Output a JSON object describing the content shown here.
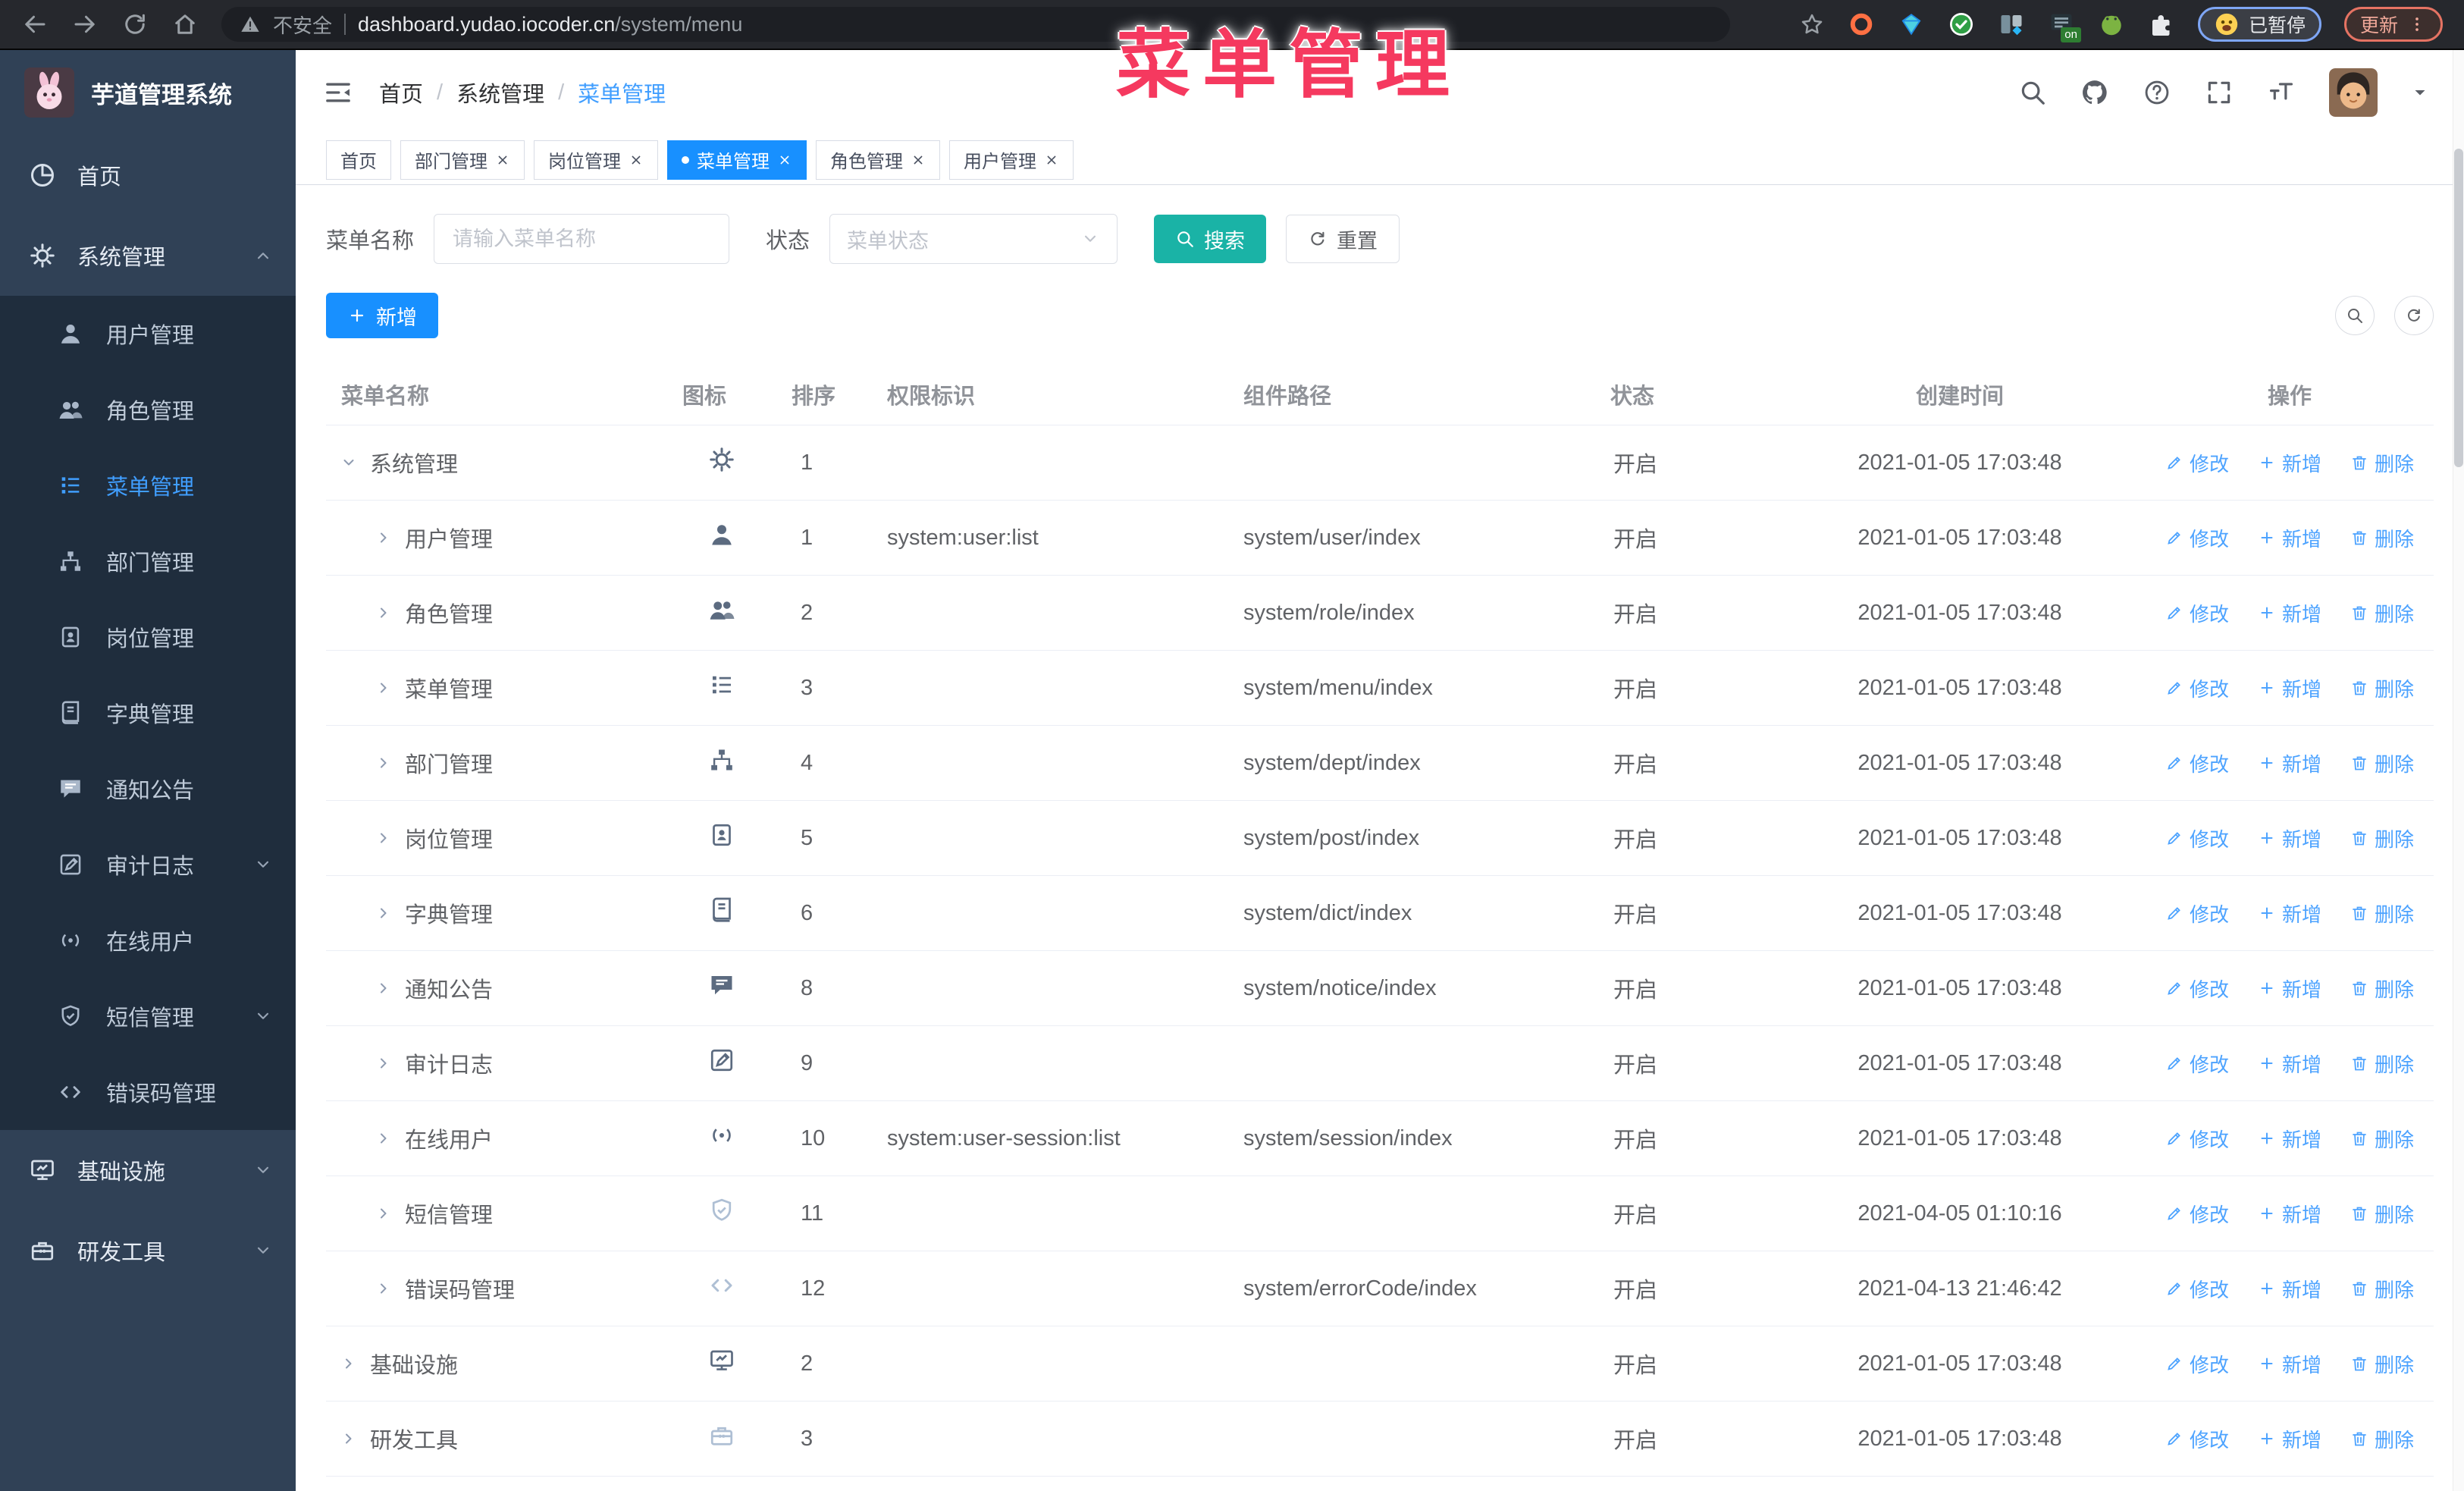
{
  "colors": {
    "primary": "#1890ff",
    "sidebar_active": "#409eff",
    "search_teal": "#1ab3a6",
    "overlay_pink": "#f5395f",
    "sidebar_bg": "#304156",
    "submenu_bg": "#1f2d3d"
  },
  "browser": {
    "security_label": "不安全",
    "url_host": "dashboard.yudao.iocoder.cn",
    "url_path": "/system/menu",
    "ext_on_badge": "on",
    "paused_badge": "已暂停",
    "update_button": "更新"
  },
  "overlay_title": "菜单管理",
  "sidebar": {
    "logo_title": "芋道管理系统",
    "items": [
      {
        "icon": "dashboard-icon",
        "label": "首页",
        "type": "root"
      },
      {
        "icon": "gear-icon",
        "label": "系统管理",
        "type": "root",
        "chevron": "up"
      },
      {
        "icon": "user-icon",
        "label": "用户管理",
        "type": "sub"
      },
      {
        "icon": "users-icon",
        "label": "角色管理",
        "type": "sub"
      },
      {
        "icon": "menu-list-icon",
        "label": "菜单管理",
        "type": "sub",
        "active": true
      },
      {
        "icon": "sitemap-icon",
        "label": "部门管理",
        "type": "sub"
      },
      {
        "icon": "badge-icon",
        "label": "岗位管理",
        "type": "sub"
      },
      {
        "icon": "book-icon",
        "label": "字典管理",
        "type": "sub"
      },
      {
        "icon": "comment-icon",
        "label": "通知公告",
        "type": "sub"
      },
      {
        "icon": "audit-log-icon",
        "label": "审计日志",
        "type": "sub",
        "chevron": "down"
      },
      {
        "icon": "online-user-icon",
        "label": "在线用户",
        "type": "sub"
      },
      {
        "icon": "shield-icon",
        "label": "短信管理",
        "type": "sub",
        "chevron": "down"
      },
      {
        "icon": "code-icon",
        "label": "错误码管理",
        "type": "sub"
      },
      {
        "icon": "monitor-icon",
        "label": "基础设施",
        "type": "root",
        "chevron": "down"
      },
      {
        "icon": "toolbox-icon",
        "label": "研发工具",
        "type": "root",
        "chevron": "down"
      }
    ]
  },
  "header": {
    "breadcrumb": [
      "首页",
      "系统管理",
      "菜单管理"
    ],
    "breadcrumb_separator": "/"
  },
  "tabs": [
    {
      "label": "首页",
      "closable": false,
      "active": false
    },
    {
      "label": "部门管理",
      "closable": true,
      "active": false
    },
    {
      "label": "岗位管理",
      "closable": true,
      "active": false
    },
    {
      "label": "菜单管理",
      "closable": true,
      "active": true
    },
    {
      "label": "角色管理",
      "closable": true,
      "active": false
    },
    {
      "label": "用户管理",
      "closable": true,
      "active": false
    }
  ],
  "filters": {
    "name_label": "菜单名称",
    "name_placeholder": "请输入菜单名称",
    "name_value": "",
    "status_label": "状态",
    "status_placeholder": "菜单状态",
    "search_button": "搜索",
    "reset_button": "重置"
  },
  "toolbar": {
    "add_button": "新增"
  },
  "table": {
    "columns": [
      "菜单名称",
      "图标",
      "排序",
      "权限标识",
      "组件路径",
      "状态",
      "创建时间",
      "操作"
    ],
    "actions": {
      "edit": "修改",
      "add": "新增",
      "delete": "删除"
    },
    "rows": [
      {
        "name": "系统管理",
        "depth": 1,
        "expanded": true,
        "icon": "gear-icon",
        "icon_light": false,
        "order": "1",
        "perm": "",
        "path": "",
        "status": "开启",
        "time": "2021-01-05 17:03:48"
      },
      {
        "name": "用户管理",
        "depth": 2,
        "expanded": false,
        "icon": "user-icon",
        "icon_light": false,
        "order": "1",
        "perm": "system:user:list",
        "path": "system/user/index",
        "status": "开启",
        "time": "2021-01-05 17:03:48"
      },
      {
        "name": "角色管理",
        "depth": 2,
        "expanded": false,
        "icon": "users-icon",
        "icon_light": false,
        "order": "2",
        "perm": "",
        "path": "system/role/index",
        "status": "开启",
        "time": "2021-01-05 17:03:48"
      },
      {
        "name": "菜单管理",
        "depth": 2,
        "expanded": false,
        "icon": "menu-list-icon",
        "icon_light": false,
        "order": "3",
        "perm": "",
        "path": "system/menu/index",
        "status": "开启",
        "time": "2021-01-05 17:03:48"
      },
      {
        "name": "部门管理",
        "depth": 2,
        "expanded": false,
        "icon": "sitemap-icon",
        "icon_light": false,
        "order": "4",
        "perm": "",
        "path": "system/dept/index",
        "status": "开启",
        "time": "2021-01-05 17:03:48"
      },
      {
        "name": "岗位管理",
        "depth": 2,
        "expanded": false,
        "icon": "badge-icon",
        "icon_light": false,
        "order": "5",
        "perm": "",
        "path": "system/post/index",
        "status": "开启",
        "time": "2021-01-05 17:03:48"
      },
      {
        "name": "字典管理",
        "depth": 2,
        "expanded": false,
        "icon": "book-icon",
        "icon_light": false,
        "order": "6",
        "perm": "",
        "path": "system/dict/index",
        "status": "开启",
        "time": "2021-01-05 17:03:48"
      },
      {
        "name": "通知公告",
        "depth": 2,
        "expanded": false,
        "icon": "comment-icon",
        "icon_light": false,
        "order": "8",
        "perm": "",
        "path": "system/notice/index",
        "status": "开启",
        "time": "2021-01-05 17:03:48"
      },
      {
        "name": "审计日志",
        "depth": 2,
        "expanded": false,
        "icon": "audit-log-icon",
        "icon_light": false,
        "order": "9",
        "perm": "",
        "path": "",
        "status": "开启",
        "time": "2021-01-05 17:03:48"
      },
      {
        "name": "在线用户",
        "depth": 2,
        "expanded": false,
        "icon": "online-user-icon",
        "icon_light": false,
        "order": "10",
        "perm": "system:user-session:list",
        "path": "system/session/index",
        "status": "开启",
        "time": "2021-01-05 17:03:48"
      },
      {
        "name": "短信管理",
        "depth": 2,
        "expanded": false,
        "icon": "shield-icon",
        "icon_light": true,
        "order": "11",
        "perm": "",
        "path": "",
        "status": "开启",
        "time": "2021-04-05 01:10:16"
      },
      {
        "name": "错误码管理",
        "depth": 2,
        "expanded": false,
        "icon": "code-icon",
        "icon_light": true,
        "order": "12",
        "perm": "",
        "path": "system/errorCode/index",
        "status": "开启",
        "time": "2021-04-13 21:46:42"
      },
      {
        "name": "基础设施",
        "depth": 1,
        "expanded": false,
        "icon": "monitor-icon",
        "icon_light": false,
        "order": "2",
        "perm": "",
        "path": "",
        "status": "开启",
        "time": "2021-01-05 17:03:48"
      },
      {
        "name": "研发工具",
        "depth": 1,
        "expanded": false,
        "icon": "toolbox-icon",
        "icon_light": true,
        "order": "3",
        "perm": "",
        "path": "",
        "status": "开启",
        "time": "2021-01-05 17:03:48"
      }
    ]
  }
}
